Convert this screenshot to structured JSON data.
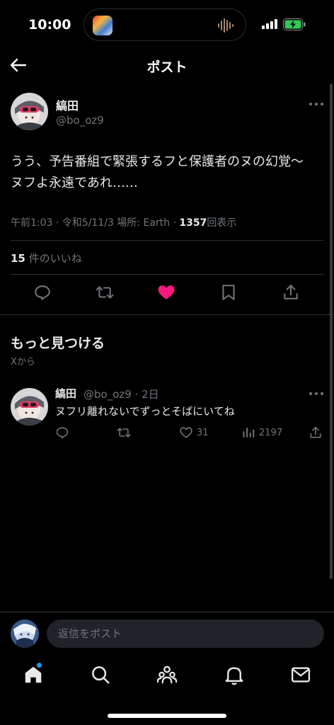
{
  "status_bar": {
    "time": "10:00"
  },
  "header": {
    "title": "ポスト"
  },
  "post": {
    "display_name": "縞田",
    "handle": "@bo_oz9",
    "text_line1": "うう、予告番組で緊張するフと保護者のヌの幻覚〜",
    "text_line2": "ヌフよ永遠であれ……",
    "timestamp": "午前1:03 · 令和5/11/3 場所: Earth · ",
    "views_count": "1357",
    "views_label": "回表示",
    "likes_count": "15",
    "likes_label": "件のいいね",
    "liked": true
  },
  "more_section": {
    "title": "もっと見つける",
    "subtitle": "Xから"
  },
  "recommended_post": {
    "display_name": "縞田",
    "handle_time": "@bo_oz9 · 2日",
    "text": "ヌフリ離れないでずっとそばにいてね",
    "likes": "31",
    "views": "2197"
  },
  "reply_bar": {
    "placeholder": "返信をポスト"
  },
  "tabs": [
    "home-icon",
    "search-icon",
    "communities-icon",
    "notifications-icon",
    "messages-icon"
  ],
  "colors": {
    "like": "#f91880",
    "accent": "#1d9bf0",
    "background": "#000000",
    "secondary_text": "#71767b"
  }
}
